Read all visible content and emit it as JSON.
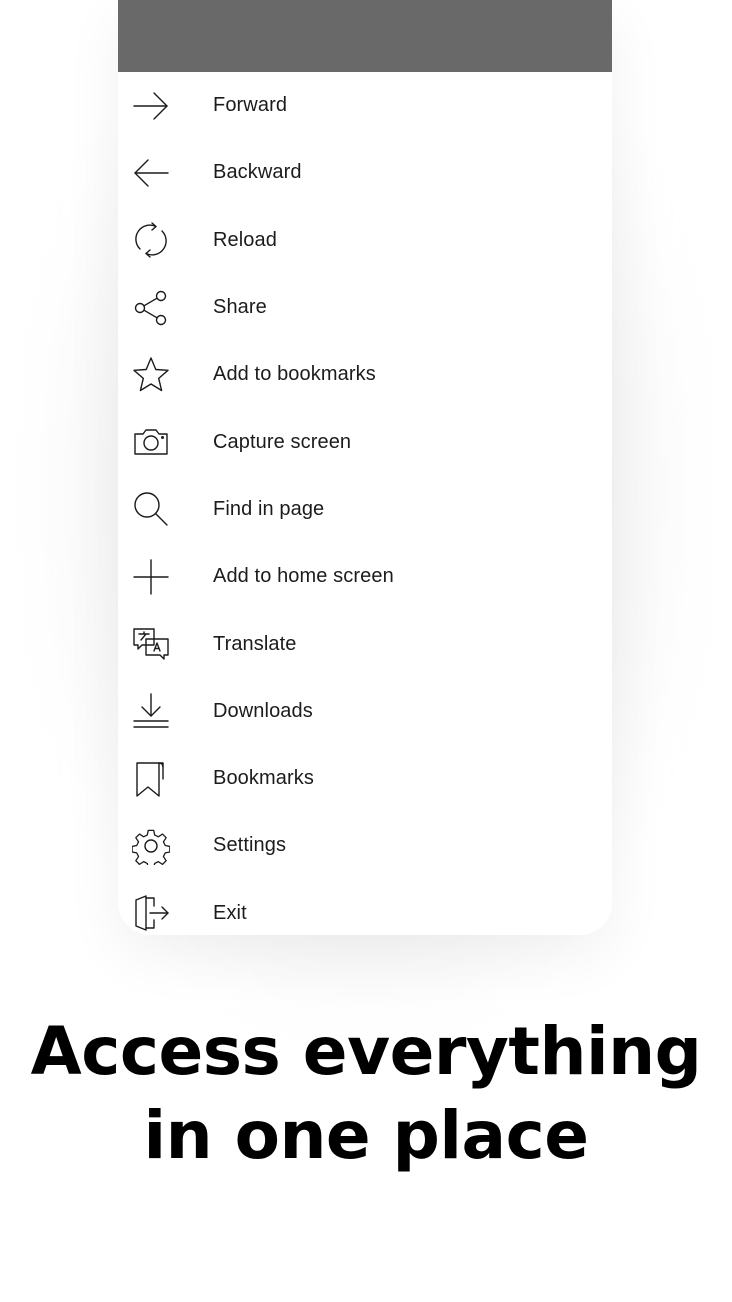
{
  "status_bar": {
    "color": "#696969"
  },
  "menu": {
    "items": [
      {
        "label": "Forward",
        "icon": "arrow-right-icon"
      },
      {
        "label": "Backward",
        "icon": "arrow-left-icon"
      },
      {
        "label": "Reload",
        "icon": "reload-icon"
      },
      {
        "label": "Share",
        "icon": "share-icon"
      },
      {
        "label": "Add to bookmarks",
        "icon": "star-icon"
      },
      {
        "label": "Capture screen",
        "icon": "camera-icon"
      },
      {
        "label": "Find in page",
        "icon": "search-icon"
      },
      {
        "label": "Add to home screen",
        "icon": "plus-icon"
      },
      {
        "label": "Translate",
        "icon": "translate-icon"
      },
      {
        "label": "Downloads",
        "icon": "download-icon"
      },
      {
        "label": "Bookmarks",
        "icon": "bookmark-icon"
      },
      {
        "label": "Settings",
        "icon": "gear-icon"
      },
      {
        "label": "Exit",
        "icon": "exit-icon"
      }
    ]
  },
  "headline": {
    "line1": "Access everything",
    "line2": "in one place"
  }
}
